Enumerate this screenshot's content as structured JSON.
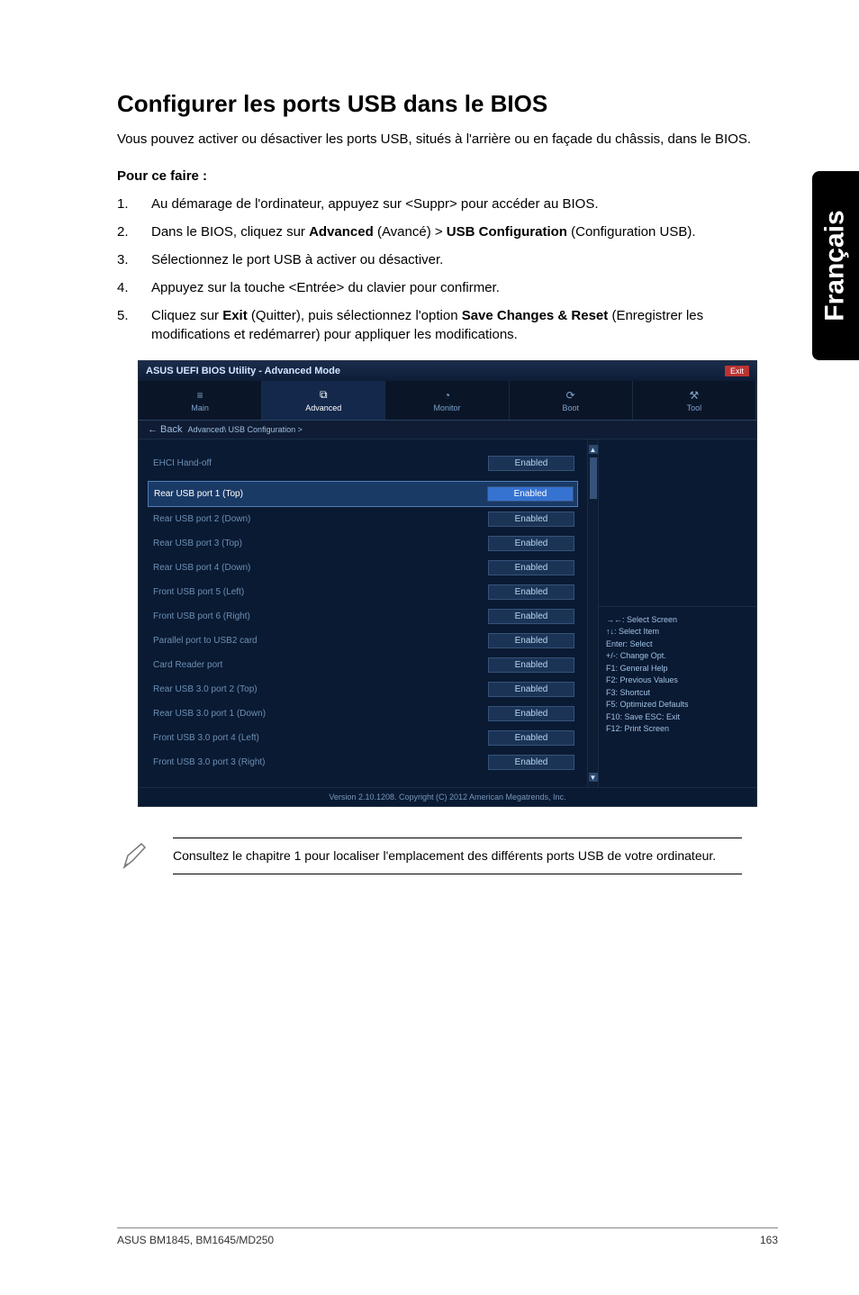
{
  "sideTab": "Français",
  "heading": "Configurer les ports USB dans le BIOS",
  "intro": "Vous pouvez activer ou désactiver les ports USB, situés à l'arrière ou en façade du châssis, dans le BIOS.",
  "subhead": "Pour ce faire :",
  "steps": [
    "Au démarage de l'ordinateur, appuyez sur <Suppr> pour accéder au BIOS.",
    "Dans le BIOS, cliquez sur <b>Advanced</b> (Avancé) > <b>USB Configuration</b> (Configuration USB).",
    "Sélectionnez le port USB à activer ou désactiver.",
    "Appuyez sur la touche <Entrée> du clavier pour confirmer.",
    "Cliquez sur <b>Exit</b> (Quitter), puis sélectionnez l'option <b>Save Changes & Reset</b> (Enregistrer les modifications et redémarrer) pour appliquer les modifications."
  ],
  "bios": {
    "titleLeft": "ASUS UEFI BIOS Utility - Advanced Mode",
    "titleRight": "Exit",
    "tabs": [
      "Main",
      "Advanced",
      "Monitor",
      "Boot",
      "Tool"
    ],
    "activeTab": 1,
    "breadcrumbBack": "← Back",
    "breadcrumb": "Advanced\\ USB Configuration >",
    "rows": [
      {
        "label": "EHCI Hand-off",
        "value": "Enabled",
        "interact": true
      },
      {
        "label": "Rear USB port 1 (Top)",
        "value": "Enabled",
        "selected": true,
        "interact": true
      },
      {
        "label": "Rear USB port 2 (Down)",
        "value": "Enabled",
        "interact": true
      },
      {
        "label": "Rear USB port 3 (Top)",
        "value": "Enabled",
        "interact": true
      },
      {
        "label": "Rear USB port 4 (Down)",
        "value": "Enabled",
        "interact": true
      },
      {
        "label": "Front USB port 5 (Left)",
        "value": "Enabled",
        "interact": true
      },
      {
        "label": "Front USB port 6 (Right)",
        "value": "Enabled",
        "interact": true
      },
      {
        "label": "Parallel port to USB2 card",
        "value": "Enabled",
        "interact": true
      },
      {
        "label": "Card Reader port",
        "value": "Enabled",
        "interact": true
      },
      {
        "label": "Rear USB 3.0 port 2 (Top)",
        "value": "Enabled",
        "interact": true
      },
      {
        "label": "Rear USB 3.0 port 1 (Down)",
        "value": "Enabled",
        "interact": true
      },
      {
        "label": "Front USB 3.0 port 4 (Left)",
        "value": "Enabled",
        "interact": true
      },
      {
        "label": "Front USB 3.0 port 3 (Right)",
        "value": "Enabled",
        "interact": true
      }
    ],
    "helpLines": [
      "→←: Select Screen",
      "↑↓: Select Item",
      "Enter: Select",
      "+/-: Change Opt.",
      "F1: General Help",
      "F2: Previous Values",
      "F3: Shortcut",
      "F5: Optimized Defaults",
      "F10: Save  ESC: Exit",
      "F12: Print Screen"
    ],
    "footer": "Version 2.10.1208. Copyright (C) 2012 American Megatrends, Inc."
  },
  "note": "Consultez le chapitre 1 pour localiser l'emplacement des différents ports USB de votre ordinateur.",
  "footerLeft": "ASUS BM1845, BM1645/MD250",
  "footerRight": "163"
}
